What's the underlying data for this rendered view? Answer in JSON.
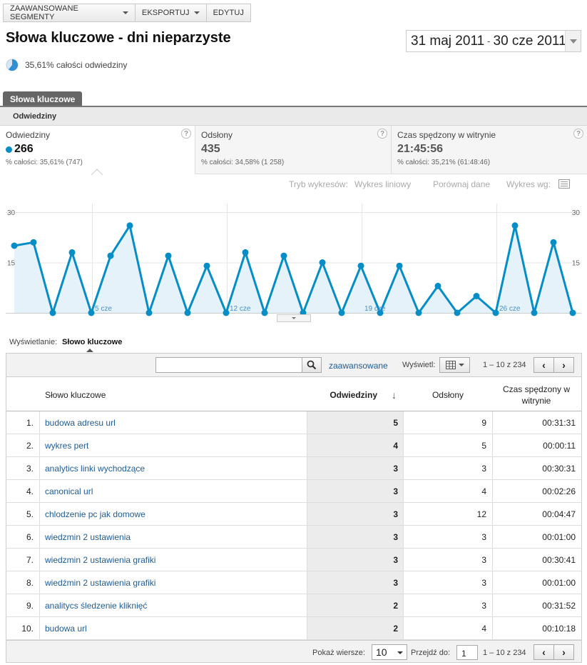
{
  "toolbar": {
    "segments": "ZAAWANSOWANE SEGMENTY",
    "export": "EKSPORTUJ",
    "edit": "EDYTUJ"
  },
  "page": {
    "title": "Słowa kluczowe - dni nieparzyste",
    "date_from": "31 maj 2011",
    "date_separator": "-",
    "date_to": "30 cze 2011",
    "segment_summary": "35,61% całości odwiedziny"
  },
  "tabs": {
    "main": "Słowa kluczowe",
    "sub": "Odwiedziny"
  },
  "metrics": [
    {
      "label": "Odwiedziny",
      "value": "266",
      "sub": "% całości: 35,61% (747)"
    },
    {
      "label": "Odsłony",
      "value": "435",
      "sub": "% całości: 34,58% (1 258)"
    },
    {
      "label": "Czas spędzony w witrynie",
      "value": "21:45:56",
      "sub": "% całości: 35,21% (61:48:46)"
    }
  ],
  "help_glyph": "?",
  "chart_controls": {
    "mode_label": "Tryb wykresów:",
    "line_chart": "Wykres liniowy",
    "compare_dates": "Porównaj dane",
    "chart_by": "Wykres wg:"
  },
  "chart_data": {
    "type": "area",
    "series": [
      {
        "name": "Odwiedziny",
        "color": "#058dc7",
        "fill": "#e6f2f9",
        "values": [
          20,
          21,
          0,
          18,
          0,
          17,
          26,
          0,
          17,
          0,
          14,
          0,
          18,
          0,
          17,
          0,
          15,
          0,
          14,
          0,
          14,
          0,
          8,
          0,
          5,
          0,
          26,
          0,
          21,
          0
        ]
      }
    ],
    "x_tick_labels": [
      "5 cze",
      "12 cze",
      "19 cze",
      "26 cze"
    ],
    "x_tick_index": [
      6,
      13,
      20,
      27
    ],
    "y_ticks": [
      "30",
      "15"
    ],
    "ylim": [
      0,
      30
    ],
    "grid": true
  },
  "table": {
    "view_label": "Wyświetlanie:",
    "view_value": "Słowo kluczowe",
    "search_placeholder": "",
    "advanced": "zaawansowane",
    "display_label": "Wyświetl:",
    "range": "1 – 10 z 234",
    "prev": "‹",
    "next": "›",
    "headers": {
      "keyword": "Słowo kluczowe",
      "visits": "Odwiedziny",
      "sort_arrow": "↓",
      "pageviews": "Odsłony",
      "time": "Czas spędzony w witrynie"
    },
    "rows": [
      {
        "idx": "1.",
        "keyword": "budowa adresu url",
        "visits": "5",
        "pageviews": "9",
        "time": "00:31:31"
      },
      {
        "idx": "2.",
        "keyword": "wykres pert",
        "visits": "4",
        "pageviews": "5",
        "time": "00:00:11"
      },
      {
        "idx": "3.",
        "keyword": "analytics linki wychodzące",
        "visits": "3",
        "pageviews": "3",
        "time": "00:30:31"
      },
      {
        "idx": "4.",
        "keyword": "canonical url",
        "visits": "3",
        "pageviews": "4",
        "time": "00:02:26"
      },
      {
        "idx": "5.",
        "keyword": "chlodzenie pc jak domowe",
        "visits": "3",
        "pageviews": "12",
        "time": "00:04:47"
      },
      {
        "idx": "6.",
        "keyword": "wiedzmin 2 ustawienia",
        "visits": "3",
        "pageviews": "3",
        "time": "00:01:00"
      },
      {
        "idx": "7.",
        "keyword": "wiedzmin 2 ustawienia grafiki",
        "visits": "3",
        "pageviews": "3",
        "time": "00:30:41"
      },
      {
        "idx": "8.",
        "keyword": "wiedźmin 2 ustawienia grafiki",
        "visits": "3",
        "pageviews": "3",
        "time": "00:01:00"
      },
      {
        "idx": "9.",
        "keyword": "analitycs śledzenie kliknięć",
        "visits": "2",
        "pageviews": "3",
        "time": "00:31:52"
      },
      {
        "idx": "10.",
        "keyword": "budowa url",
        "visits": "2",
        "pageviews": "4",
        "time": "00:10:18"
      }
    ],
    "footer": {
      "rows_label": "Pokaż wiersze:",
      "rows_value": "10",
      "goto_label": "Przejdź do:",
      "goto_value": "1",
      "range": "1 – 10 z 234"
    }
  }
}
